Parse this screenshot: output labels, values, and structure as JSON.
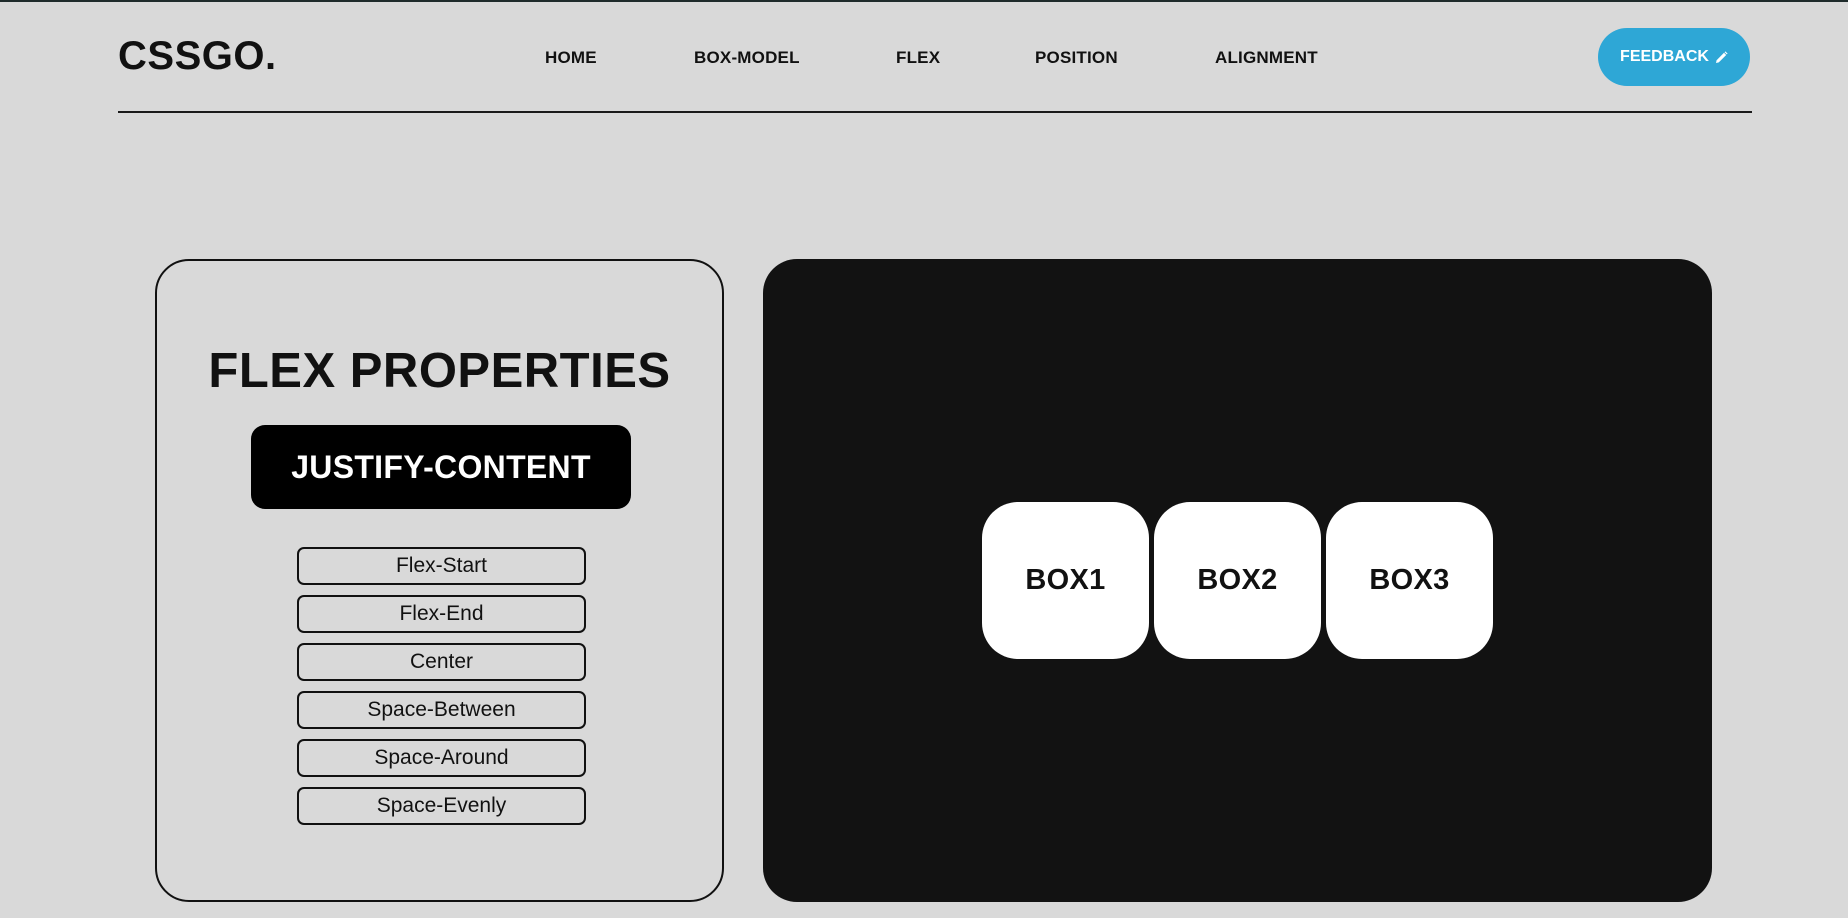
{
  "header": {
    "logo": "CSSGO.",
    "nav": [
      "HOME",
      "BOX-MODEL",
      "FLEX",
      "POSITION",
      "ALIGNMENT"
    ],
    "feedback_label": "FEEDBACK",
    "feedback_icon": "pencil-icon"
  },
  "props_panel": {
    "title": "FLEX PROPERTIES",
    "property": "JUSTIFY-CONTENT",
    "options": [
      "Flex-Start",
      "Flex-End",
      "Center",
      "Space-Between",
      "Space-Around",
      "Space-Evenly"
    ]
  },
  "preview": {
    "boxes": [
      "BOX1",
      "BOX2",
      "BOX3"
    ]
  },
  "colors": {
    "background": "#d9d9d9",
    "accent": "#2ea7d6",
    "preview_bg": "#121212",
    "box_bg": "#ffffff"
  }
}
